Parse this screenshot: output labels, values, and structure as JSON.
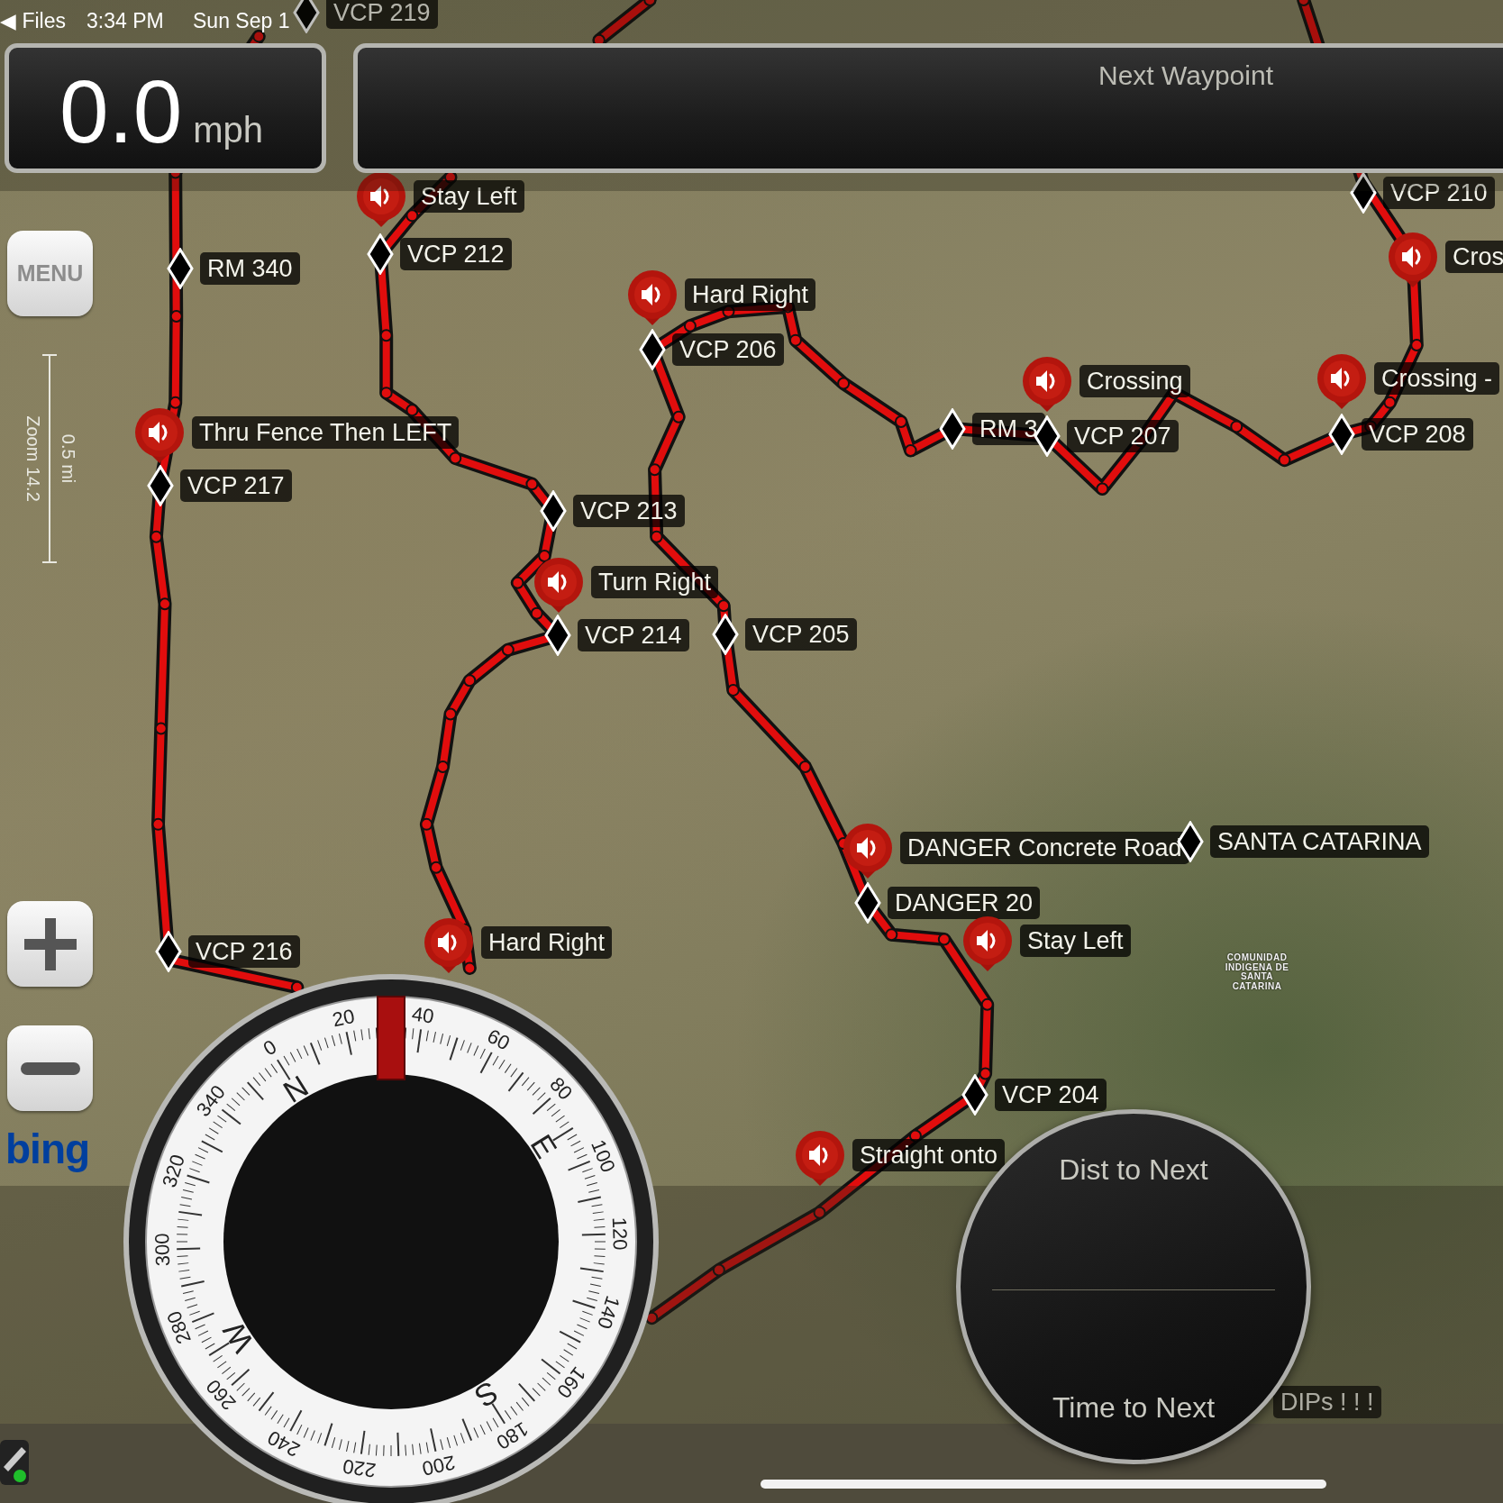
{
  "status_bar": {
    "back": "◀ Files",
    "time": "3:34 PM",
    "date": "Sun Sep 1"
  },
  "speed_panel": {
    "value": "0.0",
    "unit": "mph"
  },
  "next_waypoint_panel": {
    "title": "Next Waypoint"
  },
  "menu_button": {
    "label": "MENU"
  },
  "scale_bar": {
    "zoom": "Zoom 14.2",
    "distance": "0.5 mi"
  },
  "map": {
    "attribution": "bing",
    "place_label": "COMUNIDAD INDIGENA DE SANTA CATARINA",
    "waypoints": [
      {
        "kind": "diamond",
        "label": "VCP 219"
      },
      {
        "kind": "voice",
        "label": "Stay Left"
      },
      {
        "kind": "diamond",
        "label": "VCP 210"
      },
      {
        "kind": "diamond",
        "label": "RM 340"
      },
      {
        "kind": "diamond",
        "label": "VCP 212"
      },
      {
        "kind": "voice",
        "label": "Cros"
      },
      {
        "kind": "voice",
        "label": "Hard Right"
      },
      {
        "kind": "diamond",
        "label": "VCP 206"
      },
      {
        "kind": "voice",
        "label": "Crossing"
      },
      {
        "kind": "voice",
        "label": "Crossing -"
      },
      {
        "kind": "voice",
        "label": "Thru Fence Then LEFT"
      },
      {
        "kind": "diamond",
        "label": "RM 3"
      },
      {
        "kind": "diamond",
        "label": "VCP 207"
      },
      {
        "kind": "diamond",
        "label": "VCP 208"
      },
      {
        "kind": "diamond",
        "label": "VCP 217"
      },
      {
        "kind": "diamond",
        "label": "VCP 213"
      },
      {
        "kind": "voice",
        "label": "Turn Right"
      },
      {
        "kind": "diamond",
        "label": "VCP 205"
      },
      {
        "kind": "diamond",
        "label": "VCP 214"
      },
      {
        "kind": "voice",
        "label": "DANGER Concrete Road"
      },
      {
        "kind": "diamond",
        "label": "SANTA CATARINA"
      },
      {
        "kind": "diamond",
        "label": "DANGER 20"
      },
      {
        "kind": "diamond",
        "label": "VCP 216"
      },
      {
        "kind": "voice",
        "label": "Hard Right"
      },
      {
        "kind": "voice",
        "label": "Stay Left"
      },
      {
        "kind": "diamond",
        "label": "VCP 204"
      },
      {
        "kind": "voice",
        "label": "Straight onto"
      },
      {
        "kind": "label",
        "label": "DIPs ! ! !"
      }
    ]
  },
  "compass": {
    "degree_labels": [
      "0",
      "20",
      "40",
      "60",
      "80",
      "100",
      "120",
      "140",
      "160",
      "180",
      "200",
      "220",
      "240",
      "260",
      "280",
      "300",
      "320",
      "340"
    ],
    "cardinal_labels": [
      "N",
      "E",
      "S",
      "W"
    ]
  },
  "next_info": {
    "distance_label": "Dist to Next",
    "time_label": "Time to Next"
  }
}
